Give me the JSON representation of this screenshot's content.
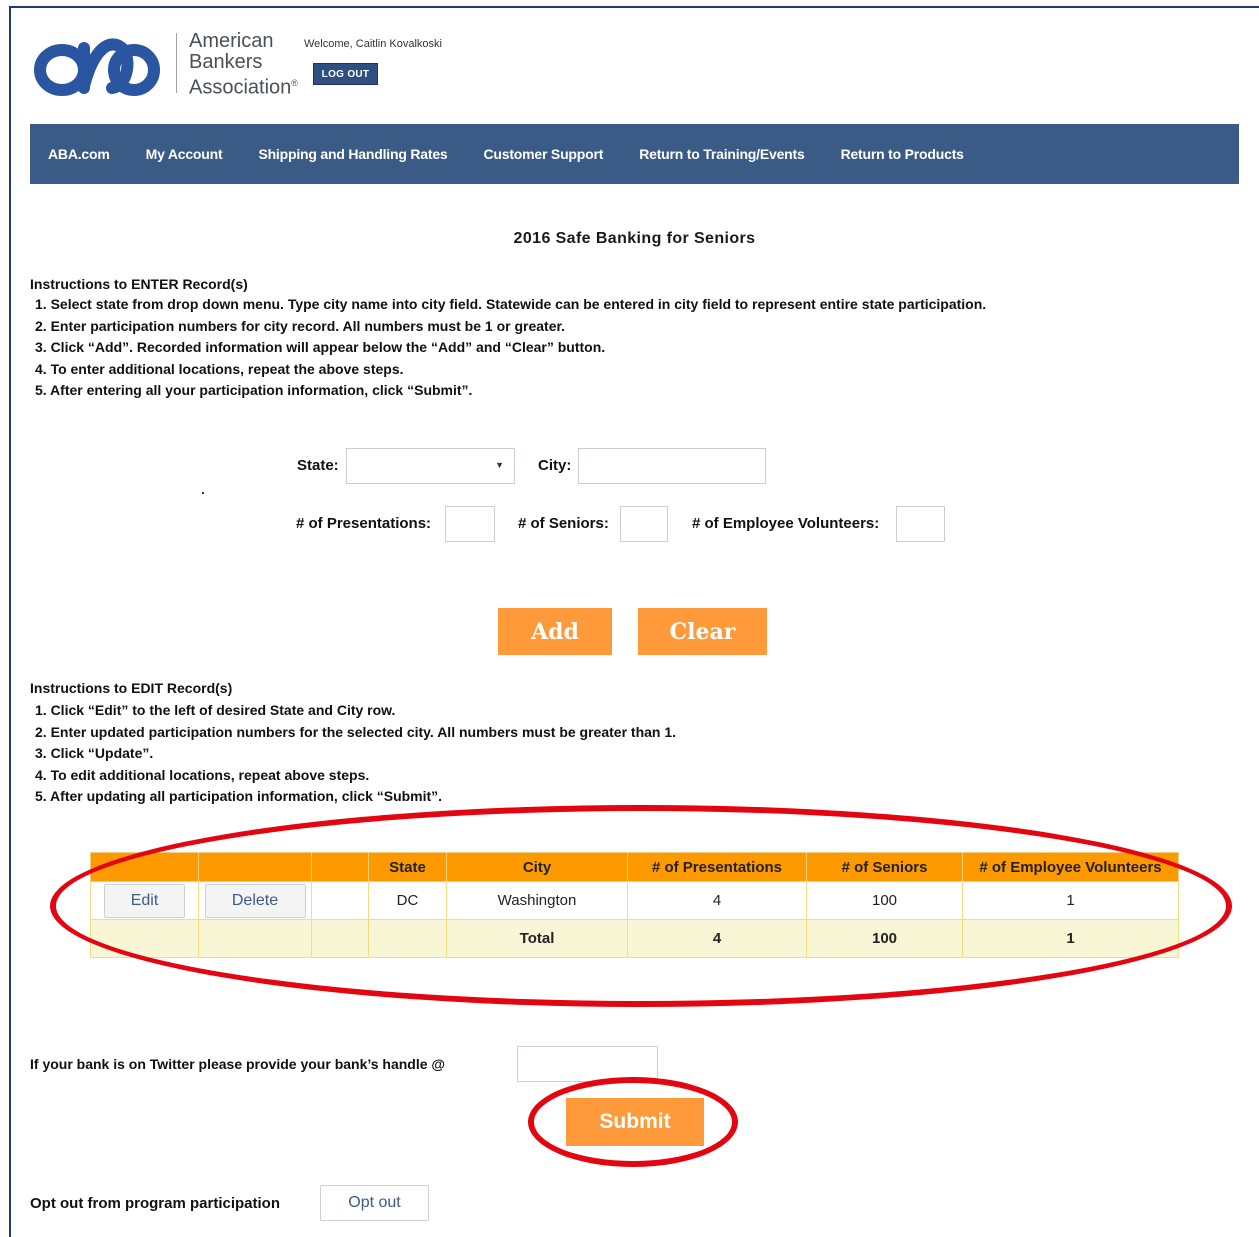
{
  "brand": {
    "line1": "American",
    "line2": "Bankers",
    "line3": "Association",
    "mark": "®"
  },
  "user": {
    "welcome": "Welcome, Caitlin Kovalkoski",
    "logout_label": "LOG OUT"
  },
  "nav": {
    "items": [
      "ABA.com",
      "My Account",
      "Shipping and Handling Rates",
      "Customer Support",
      "Return to Training/Events",
      "Return to Products"
    ]
  },
  "page": {
    "title": "2016 Safe Banking for Seniors"
  },
  "enter_instructions": {
    "heading": "Instructions to ENTER Record(s)",
    "steps": [
      "1. Select state from drop down menu. Type city name into city field. Statewide can be entered in city field to represent entire state participation.",
      "2. Enter participation numbers for city record. All numbers must be 1 or greater.",
      "3. Click “Add”. Recorded information will appear below the “Add” and “Clear” button.",
      "4. To enter additional locations, repeat the above steps.",
      "5. After entering all your participation information, click “Submit”."
    ]
  },
  "form": {
    "state_label": "State:",
    "state_value": "",
    "city_label": "City:",
    "city_value": "",
    "presentations_label": "# of Presentations:",
    "presentations_value": "",
    "seniors_label": "# of Seniors:",
    "seniors_value": "",
    "volunteers_label": "# of Employee Volunteers:",
    "volunteers_value": "",
    "add_label": "Add",
    "clear_label": "Clear"
  },
  "edit_instructions": {
    "heading": "Instructions to EDIT Record(s)",
    "steps": [
      "1. Click “Edit” to the left of desired State and City row.",
      "2. Enter updated participation numbers for the selected city. All numbers must be greater than 1.",
      "3. Click “Update”.",
      "4. To edit additional locations, repeat above steps.",
      "5. After updating all participation information, click “Submit”."
    ]
  },
  "table": {
    "headers": [
      "",
      "",
      "",
      "State",
      "City",
      "# of Presentations",
      "# of Seniors",
      "# of Employee Volunteers"
    ],
    "rows": [
      {
        "edit": "Edit",
        "delete": "Delete",
        "state": "DC",
        "city": "Washington",
        "presentations": "4",
        "seniors": "100",
        "volunteers": "1"
      }
    ],
    "total": {
      "label": "Total",
      "presentations": "4",
      "seniors": "100",
      "volunteers": "1"
    }
  },
  "twitter": {
    "label": "If your bank is on Twitter please provide your bank’s handle @",
    "value": ""
  },
  "submit_label": "Submit",
  "optout": {
    "label": "Opt out from program participation",
    "button": "Opt out"
  },
  "colors": {
    "nav": "#3a5b85",
    "accent": "#fe9a3a",
    "table_header": "#fe9a00",
    "highlight": "#e30611"
  }
}
